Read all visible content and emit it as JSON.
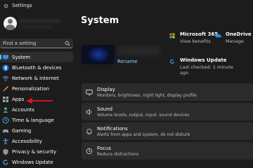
{
  "window": {
    "title": "Settings"
  },
  "sidebar": {
    "search_placeholder": "Find a setting",
    "items": [
      {
        "label": "System",
        "icon": "monitor-icon",
        "active": true
      },
      {
        "label": "Bluetooth & devices",
        "icon": "bluetooth-icon"
      },
      {
        "label": "Network & internet",
        "icon": "wifi-icon"
      },
      {
        "label": "Personalization",
        "icon": "brush-icon"
      },
      {
        "label": "Apps",
        "icon": "apps-icon"
      },
      {
        "label": "Accounts",
        "icon": "person-icon"
      },
      {
        "label": "Time & language",
        "icon": "globe-clock-icon"
      },
      {
        "label": "Gaming",
        "icon": "gamepad-icon"
      },
      {
        "label": "Accessibility",
        "icon": "accessibility-icon"
      },
      {
        "label": "Privacy & security",
        "icon": "shield-icon"
      },
      {
        "label": "Windows Update",
        "icon": "update-icon"
      }
    ]
  },
  "main": {
    "title": "System",
    "device": {
      "rename_label": "Rename"
    },
    "microsoft365": {
      "title": "Microsoft 365",
      "subtitle": "View benefits"
    },
    "onedrive": {
      "title": "OneDrive",
      "subtitle": "Manage"
    },
    "windows_update": {
      "title": "Windows Update",
      "subtitle_line1": "Last checked: 1 minute",
      "subtitle_line2": "ago"
    },
    "cards": [
      {
        "title": "Display",
        "subtitle": "Monitors, brightness, night light, display profile",
        "icon": "display-icon"
      },
      {
        "title": "Sound",
        "subtitle": "Volume levels, output, input, sound devices",
        "icon": "speaker-icon"
      },
      {
        "title": "Notifications",
        "subtitle": "Alerts from apps and system, do not disturb",
        "icon": "bell-icon"
      },
      {
        "title": "Focus",
        "subtitle": "Reduce distractions",
        "icon": "focus-icon"
      }
    ]
  },
  "colors": {
    "accent": "#4cc2ff",
    "arrow": "#e81123",
    "background": "#1c1c1c",
    "card": "#2b2b2b"
  }
}
